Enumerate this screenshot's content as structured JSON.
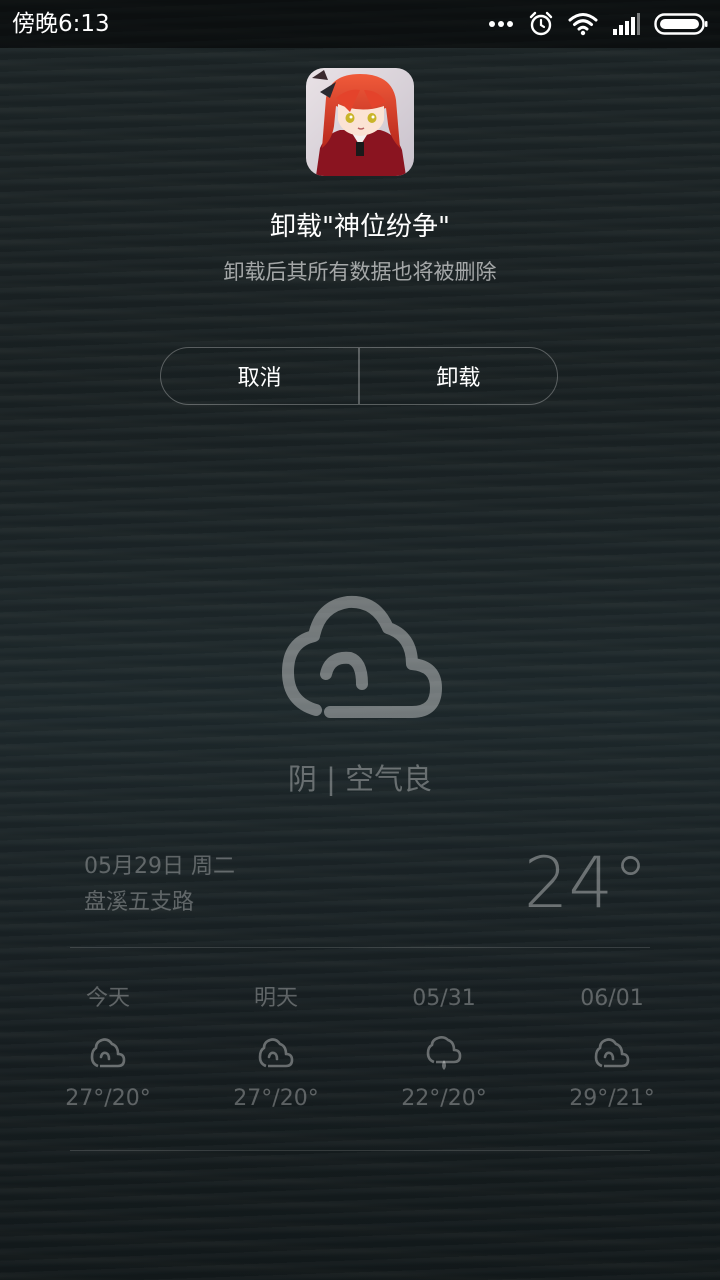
{
  "status_bar": {
    "time": "傍晚6:13",
    "icons": [
      "more-dots-icon",
      "alarm-icon",
      "wifi-icon",
      "signal-icon",
      "battery-icon"
    ]
  },
  "uninstall_dialog": {
    "app_icon": "anime-girl-app-icon",
    "title": "卸载\"神位纷争\"",
    "message": "卸载后其所有数据也将被删除",
    "cancel_label": "取消",
    "confirm_label": "卸载"
  },
  "weather": {
    "condition_icon": "cloud-icon",
    "condition": "阴 | 空气良",
    "date": "05月29日 周二",
    "location": "盘溪五支路",
    "temperature": "24°",
    "forecast": [
      {
        "day": "今天",
        "icon": "cloud-icon",
        "temp": "27°/20°"
      },
      {
        "day": "明天",
        "icon": "cloud-icon",
        "temp": "27°/20°"
      },
      {
        "day": "05/31",
        "icon": "rain-cloud-icon",
        "temp": "22°/20°"
      },
      {
        "day": "06/01",
        "icon": "cloud-icon",
        "temp": "29°/21°"
      }
    ]
  },
  "colors": {
    "background": "#1a2224",
    "text_primary": "#ffffff",
    "text_dim": "rgba(255,255,255,0.3)"
  }
}
